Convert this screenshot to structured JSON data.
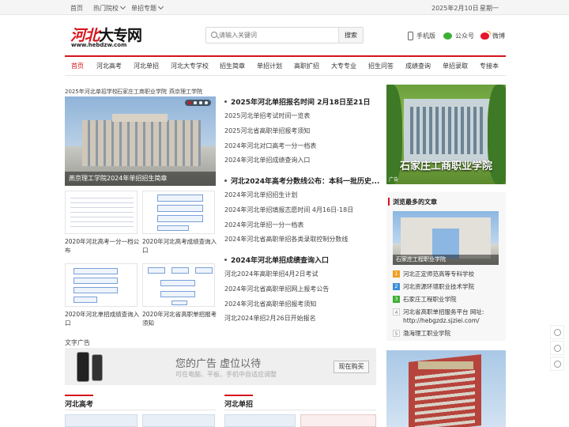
{
  "topbar": {
    "home": "首页",
    "hot_schools": "热门院校",
    "special": "单招专题",
    "date": "2025年2月10日",
    "weekday": "星期一"
  },
  "logo": {
    "text_red": "河北",
    "text_black": "大专网",
    "url": "www.hebdzw.com"
  },
  "search": {
    "placeholder": "请输入关键词",
    "button": "搜索"
  },
  "header_links": {
    "mobile": "手机版",
    "wechat": "公众号",
    "weibo": "微博"
  },
  "nav": [
    "首页",
    "河北高考",
    "河北单招",
    "河北大专学校",
    "招生简章",
    "单招计划",
    "高职扩招",
    "大专专业",
    "招生问答",
    "成绩查询",
    "单招录取",
    "专接本"
  ],
  "breadcrumb": [
    "2025年河北单招学校",
    "石家庄工商职业学院",
    "燕京理工学院"
  ],
  "slider": {
    "caption": "燕京理工学院2024年单招招生简章",
    "active_dot": 0,
    "dot_count": 4
  },
  "thumbs": [
    {
      "caption": "2020年河北高考一分一档公布"
    },
    {
      "caption": "2020年河北高考成绩查询入口"
    },
    {
      "caption": "2020年河北单招成绩查询入口"
    },
    {
      "caption": "2020年河北省高职单招报考须知"
    }
  ],
  "news_groups": [
    {
      "headline": "2025年河北单招报名时间 2月18日至21日",
      "items": [
        "2025河北单招考试时间一览表",
        "2025河北省高职单招报考须知",
        "2024年河北对口高考一分一档表",
        "2024年河北单招成绩查询入口"
      ]
    },
    {
      "headline": "河北2024年高考分数线公布：本科一批历史...",
      "items": [
        "2024年河北单招招生计划",
        "2024年河北单招填报志愿时间 4月16日-18日",
        "2024年河北单招一分一档表",
        "2024年河北省高职单招各类录取控制分数线"
      ]
    },
    {
      "headline": "2024年河北单招成绩查询入口",
      "items": [
        "河北2024年高职单招4月2日考试",
        "2024年河北省高职单招网上报考公告",
        "2024年河北省高职单招报考须知",
        "河北2024单招2月26日开始报名"
      ]
    }
  ],
  "ad": {
    "label": "文字广告",
    "title": "您的广告 虚位以待",
    "subtitle": "可在电脑、平板、手机中自适应调整",
    "button": "现在购买"
  },
  "sections": [
    {
      "title": "河北高考"
    },
    {
      "title": "河北单招"
    }
  ],
  "right_banner": {
    "title": "石家庄工商职业学院",
    "tag": "广告"
  },
  "most_viewed": {
    "title": "浏览最多的文章",
    "image_caption": "石家庄工程职业学院",
    "items": [
      {
        "num": "1",
        "text": "河北正定师范高等专科学校"
      },
      {
        "num": "2",
        "text": "河北资源环境职业技术学院"
      },
      {
        "num": "3",
        "text": "石家庄工程职业学院"
      },
      {
        "num": "4",
        "text": "河北省高职单招服务平台 网址: http://hebgzdz.sjziei.com/"
      },
      {
        "num": "5",
        "text": "渤海理工职业学院"
      }
    ]
  },
  "colors": {
    "brand_red": "#d7141b",
    "rank_1": "#f0a023",
    "rank_2": "#3d8fd9",
    "rank_3": "#3cb034"
  }
}
